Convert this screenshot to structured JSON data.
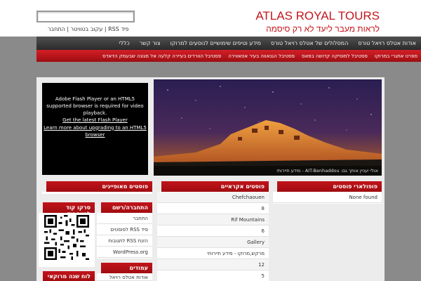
{
  "site": {
    "title": "ATLAS ROYAL TOURS",
    "tagline": "לראות מעבר ליעד לא רק סיסמה"
  },
  "search": {
    "placeholder": ""
  },
  "top_links": {
    "text": "פיד RSS | עקוב בטוויטר | התחבר"
  },
  "nav_main": [
    "אודות אטלס רויאל טורס",
    "המסלולים של אטלס רויאל טורס",
    "מידע וטיפים שימושיים לנוסעים למרוקו",
    "צור קשר",
    "כללי"
  ],
  "nav_sub": [
    "ספרט אתגרי במרוקו",
    "פסטיבל למוסיקה קדושה בפאס",
    "פסטיבל הגנאווה בעיר אסאווירה",
    "פסטיבל הוורדים בעיירה קלעה אל מגונה שבעמק הדאדס"
  ],
  "flash": {
    "message": "Adobe Flash Player or an HTML5 supported browser is required for video playback.",
    "link1": "Get the latest Flash Player",
    "link2": "Learn more about upgrading to an HTML5 browser"
  },
  "slide": {
    "caption": "אולי יעניין אותך גם: AIT-Benhaddou - מידע תיירותי"
  },
  "popular": {
    "title": "פופולארי פוסטים",
    "items": [
      "None found"
    ]
  },
  "random": {
    "title": "פוסטים אקראיים",
    "items": [
      "Chefchaouen",
      "8",
      "Rif Mountains",
      "6",
      "Gallery",
      "מרקש,מרוקו - מידע תיירותי",
      "12",
      "5"
    ]
  },
  "featured": {
    "title": "פוסטים מאופיינים"
  },
  "login": {
    "title": "התחברה/רשם",
    "items": [
      "התחבר",
      "פיד RSS לפוסטים",
      "הזנת RSS לתגובות",
      "WordPress.org"
    ]
  },
  "facebook_qr": {
    "title": "סרקו קוד לפייסבוק"
  },
  "pages": {
    "title": "עמודים",
    "items": [
      "אודות אטלס רויאל טורס"
    ]
  },
  "calendar": {
    "title": "לוח שנה מרוקאי"
  },
  "colors": {
    "accent": "#c4161c",
    "nav_dark": "#3a3a3a",
    "background": "#8a8a8a"
  }
}
